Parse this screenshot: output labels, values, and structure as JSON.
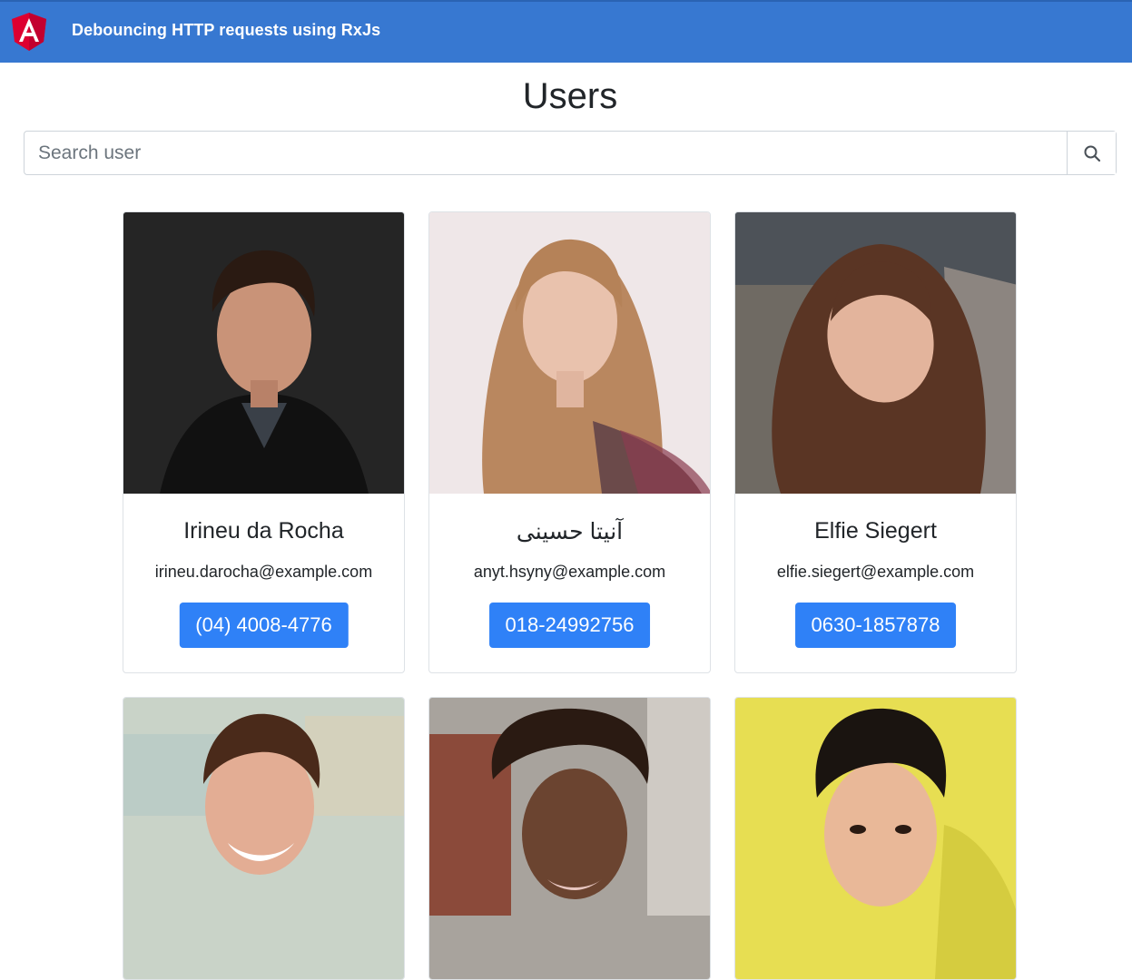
{
  "navbar": {
    "brand": "Debouncing HTTP requests using RxJs",
    "logo_icon": "angular-logo-icon",
    "color": "#3778d1"
  },
  "page": {
    "title": "Users"
  },
  "search": {
    "placeholder": "Search user",
    "value": "",
    "button_icon": "search-icon"
  },
  "users": [
    {
      "name": "Irineu da Rocha",
      "email": "irineu.darocha@example.com",
      "phone": "(04) 4008-4776",
      "photo_icon": "user-photo-icon"
    },
    {
      "name": "آنیتا حسینی",
      "email": "anyt.hsyny@example.com",
      "phone": "018-24992756",
      "photo_icon": "user-photo-icon"
    },
    {
      "name": "Elfie Siegert",
      "email": "elfie.siegert@example.com",
      "phone": "0630-1857878",
      "photo_icon": "user-photo-icon"
    },
    {
      "photo_icon": "user-photo-icon"
    },
    {
      "photo_icon": "user-photo-icon"
    },
    {
      "photo_icon": "user-photo-icon"
    }
  ],
  "colors": {
    "primary_button": "#2f81f7",
    "card_border": "#dee2e6"
  }
}
